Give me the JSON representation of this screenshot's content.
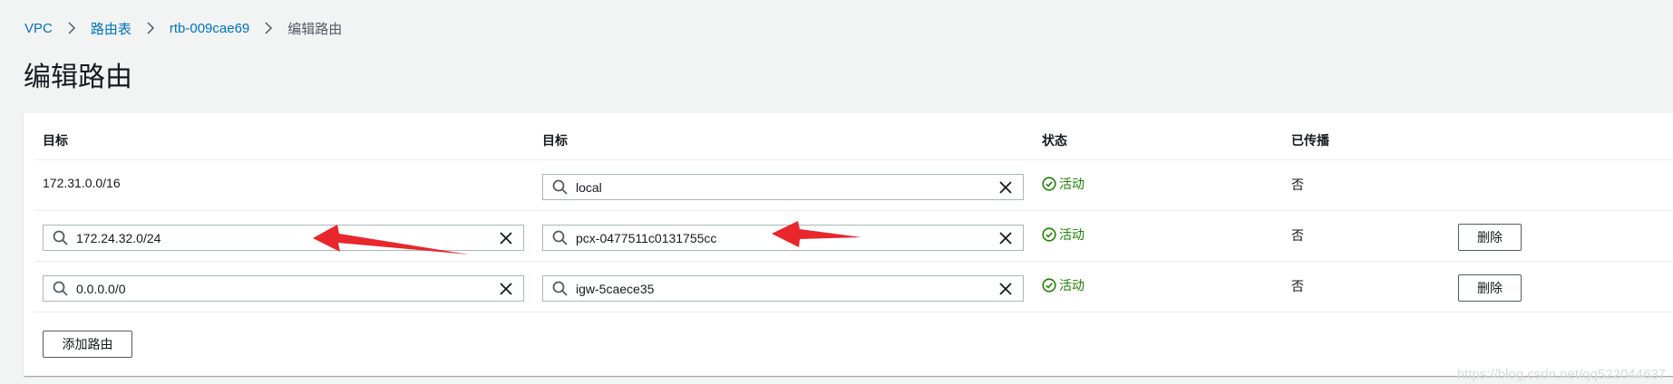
{
  "breadcrumb": {
    "items": [
      "VPC",
      "路由表",
      "rtb-009cae69"
    ],
    "current": "编辑路由"
  },
  "page": {
    "title": "编辑路由"
  },
  "table": {
    "columns": [
      "目标",
      "目标",
      "状态",
      "已传播"
    ],
    "rows": [
      {
        "destination": "172.31.0.0/16",
        "target": "local",
        "status": "活动",
        "propagated": "否",
        "removable": false
      },
      {
        "destination": "172.24.32.0/24",
        "target": "pcx-0477511c0131755cc",
        "status": "活动",
        "propagated": "否",
        "removable": true,
        "remove_label": "删除"
      },
      {
        "destination": "0.0.0.0/0",
        "target": "igw-5caece35",
        "status": "活动",
        "propagated": "否",
        "removable": true,
        "remove_label": "删除"
      }
    ]
  },
  "actions": {
    "add_route_label": "添加路由"
  },
  "annotations": {
    "arrow_color": "#e8262b"
  },
  "watermark": "https://blog.csdn.net/qq522044637",
  "colors": {
    "link": "#0073bb",
    "success": "#1d8102",
    "background": "#f2f3f3"
  },
  "icons": [
    "chevron-right-icon",
    "search-icon",
    "close-icon",
    "check-circle-icon",
    "arrow-annotation"
  ]
}
